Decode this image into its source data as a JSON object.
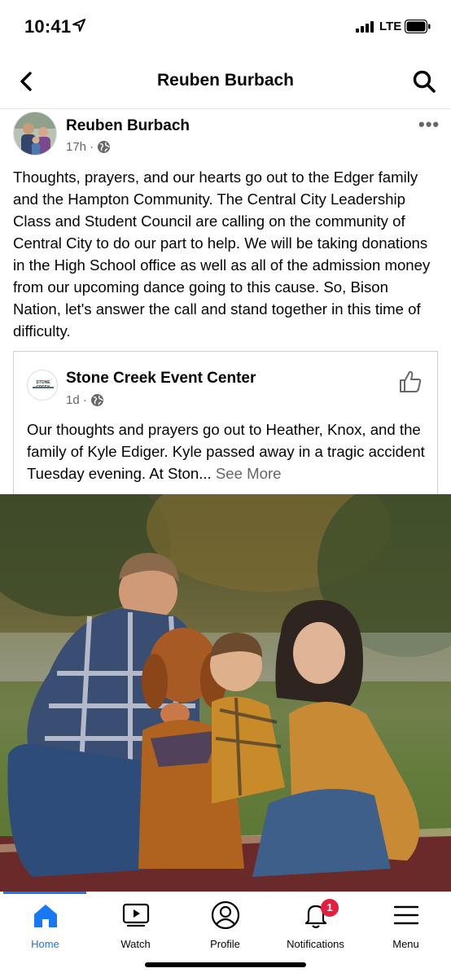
{
  "status_bar": {
    "time": "10:41",
    "network": "LTE",
    "icons": [
      "location-arrow-icon",
      "signal-icon",
      "battery-icon"
    ]
  },
  "nav": {
    "title": "Reuben Burbach",
    "icons": [
      "back-chevron-icon",
      "search-icon"
    ]
  },
  "post": {
    "author": "Reuben Burbach",
    "time": "17h",
    "separator": "·",
    "audience_icon": "globe-icon",
    "more_icon": "more-dots-icon",
    "more_label": "•••",
    "body": "Thoughts, prayers, and our hearts go out to the Edger family and the Hampton Community.  The Central City Leadership Class and Student Council are calling on the community of Central City to do our part to help. We will be taking donations in the High School office as well as all of the admission money from our upcoming dance going to this cause.  So, Bison Nation, let's answer the call and stand together in this time of difficulty."
  },
  "shared": {
    "page_name": "Stone Creek Event Center",
    "logo_text": "STONE CREEK",
    "time": "1d",
    "separator": "·",
    "audience_icon": "globe-icon",
    "like_icon": "thumbs-up-icon",
    "body": "Our thoughts and prayers go out to Heather, Knox, and the family of Kyle Ediger.  Kyle passed away in a tragic accident Tuesday evening.  At Ston...",
    "see_more": "See More"
  },
  "photo": {
    "subject": "family-with-dog-photo"
  },
  "tabs": [
    {
      "label": "Home",
      "icon": "home-icon",
      "active": true
    },
    {
      "label": "Watch",
      "icon": "watch-icon",
      "active": false
    },
    {
      "label": "Profile",
      "icon": "profile-icon",
      "active": false
    },
    {
      "label": "Notifications",
      "icon": "bell-icon",
      "active": false,
      "badge": "1"
    },
    {
      "label": "Menu",
      "icon": "menu-icon",
      "active": false
    }
  ],
  "colors": {
    "accent": "#1877f2",
    "secondary_text": "#65676b",
    "badge": "#e41e3f"
  }
}
